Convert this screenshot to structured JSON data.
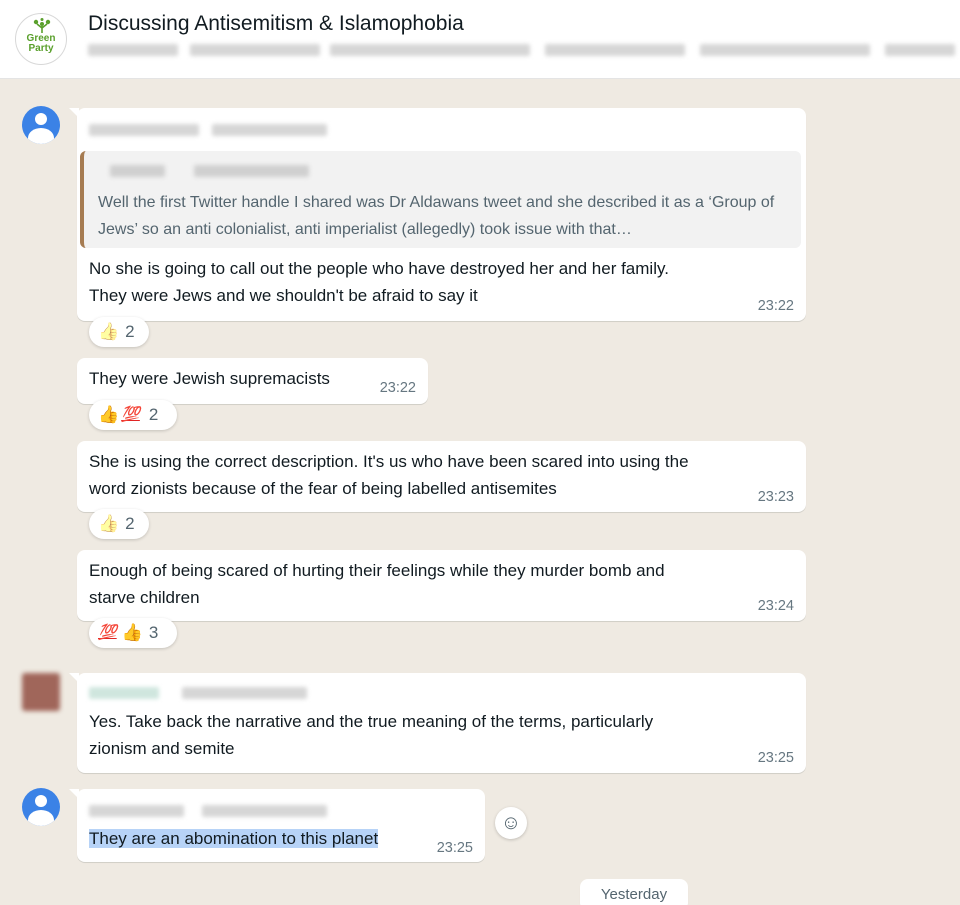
{
  "header": {
    "title": "Discussing Antisemitism & Islamophobia",
    "logo_text_line1": "Green",
    "logo_text_line2": "Party"
  },
  "messages": [
    {
      "quote": "Well the first Twitter handle I shared was Dr Aldawans tweet and she described it as a ‘Group of Jews’ so an anti colonialist, anti imperialist (allegedly) took issue with that…",
      "line1": "No she is going to call out the people who have destroyed her and her family.",
      "line2": "They were Jews and we shouldn't be afraid to say it",
      "time": "23:22",
      "reaction": {
        "emoji1": "👍",
        "count": "2"
      }
    },
    {
      "line1": "They were Jewish supremacists",
      "time": "23:22",
      "reaction": {
        "emoji1": "👍",
        "emoji2": "💯",
        "count": "2"
      }
    },
    {
      "line1": "She is using the correct description. It's us who have been scared into using the",
      "line2": "word zionists because of the fear of being labelled antisemites",
      "time": "23:23",
      "reaction": {
        "emoji1": "👍",
        "count": "2"
      }
    },
    {
      "line1": "Enough of being scared of hurting their feelings while they murder bomb and",
      "line2": "starve children",
      "time": "23:24",
      "reaction": {
        "emoji1": "💯",
        "emoji2": "👍",
        "count": "3"
      }
    },
    {
      "line1": "Yes. Take back the narrative and the true meaning of the terms, particularly",
      "line2": "zionism and semite",
      "time": "23:25"
    },
    {
      "line1": "They are an abomination to this planet",
      "time": "23:25"
    }
  ],
  "emoji_button": "☺",
  "date_divider": "Yesterday",
  "colors": {
    "chat_background": "#efeae2",
    "bubble": "#ffffff",
    "quote_bar": "#a67c52",
    "avatar_blue": "#3b82e6",
    "highlight": "#b7d3f7",
    "green_logo": "#5aa02c"
  },
  "icons": [
    "green-party-logo-icon",
    "default-user-avatar-icon",
    "thumbs-up-icon",
    "hundred-points-icon",
    "emoji-smiley-icon"
  ]
}
